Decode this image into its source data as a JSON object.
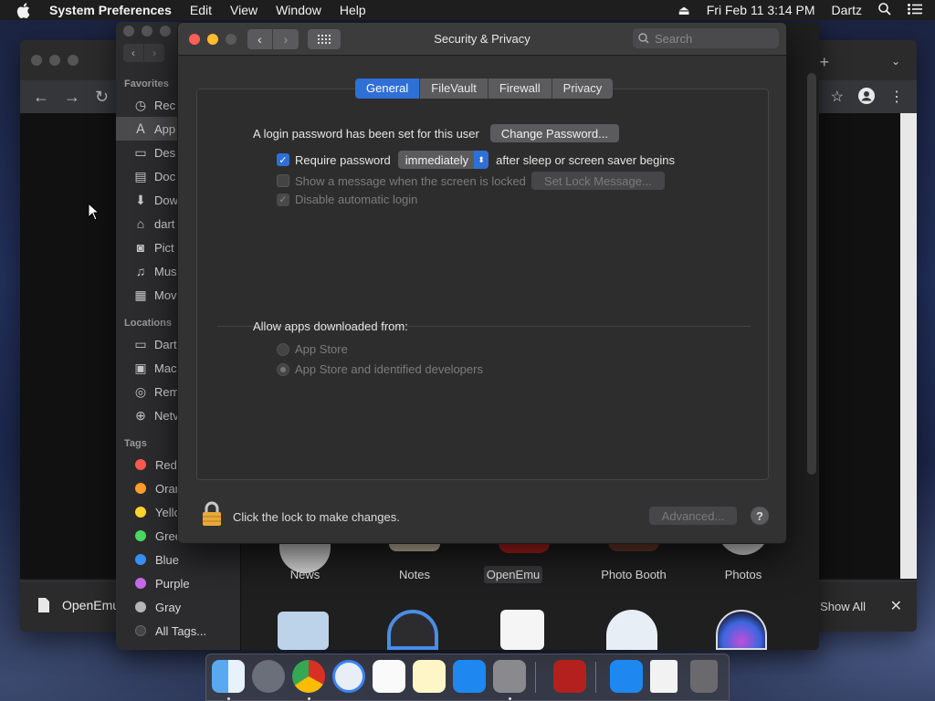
{
  "menubar": {
    "app_name": "System Preferences",
    "menus": [
      "Edit",
      "View",
      "Window",
      "Help"
    ],
    "datetime": "Fri Feb 11  3:14 PM",
    "user": "Dartz"
  },
  "chrome": {
    "download_file": "OpenEmu",
    "show_all": "Show All"
  },
  "finder": {
    "favorites_header": "Favorites",
    "favorites": [
      {
        "label": "Rec",
        "icon": "clock-icon"
      },
      {
        "label": "App",
        "icon": "applications-icon"
      },
      {
        "label": "Des",
        "icon": "desktop-icon"
      },
      {
        "label": "Doc",
        "icon": "document-icon"
      },
      {
        "label": "Dow",
        "icon": "download-icon"
      },
      {
        "label": "dart",
        "icon": "home-icon"
      },
      {
        "label": "Pict",
        "icon": "camera-icon"
      },
      {
        "label": "Mus",
        "icon": "music-icon"
      },
      {
        "label": "Mov",
        "icon": "film-icon"
      }
    ],
    "locations_header": "Locations",
    "locations": [
      {
        "label": "Dart",
        "icon": "computer-icon"
      },
      {
        "label": "Mac",
        "icon": "disk-icon"
      },
      {
        "label": "Rem",
        "icon": "disc-icon"
      },
      {
        "label": "Netv",
        "icon": "network-icon"
      }
    ],
    "tags_header": "Tags",
    "tags": [
      {
        "label": "Red",
        "color": "#ff5a52"
      },
      {
        "label": "Oran",
        "color": "#ff9f2e"
      },
      {
        "label": "Yello",
        "color": "#ffd52e"
      },
      {
        "label": "Gree",
        "color": "#4cd964"
      },
      {
        "label": "Blue",
        "color": "#3a8ef6"
      },
      {
        "label": "Purple",
        "color": "#c36be6"
      },
      {
        "label": "Gray",
        "color": "#b5b5b5"
      },
      {
        "label": "All Tags...",
        "color": "#444444"
      }
    ],
    "apps_row1": [
      "News",
      "Notes",
      "OpenEmu",
      "Photo Booth",
      "Photos"
    ]
  },
  "prefs": {
    "title": "Security & Privacy",
    "search_placeholder": "Search",
    "tabs": [
      "General",
      "FileVault",
      "Firewall",
      "Privacy"
    ],
    "active_tab": "General",
    "login_text": "A login password has been set for this user",
    "change_password": "Change Password...",
    "require_password": "Require password",
    "require_delay": "immediately",
    "after_sleep": "after sleep or screen saver begins",
    "show_message": "Show a message when the screen is locked",
    "set_lock_message": "Set Lock Message...",
    "disable_auto_login": "Disable automatic login",
    "allow_apps": "Allow apps downloaded from:",
    "app_store": "App Store",
    "app_store_dev": "App Store and identified developers",
    "lock_text": "Click the lock to make changes.",
    "advanced": "Advanced...",
    "help": "?"
  },
  "colors": {
    "accent": "#2f6fd6",
    "window_bg": "#323232",
    "panel_bg": "#2d2d2d"
  }
}
